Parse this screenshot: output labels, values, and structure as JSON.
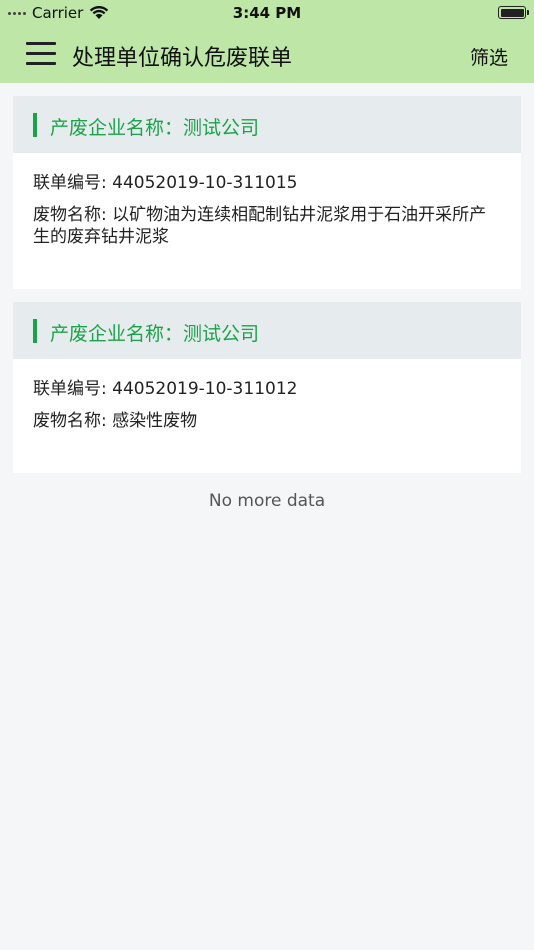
{
  "status_bar": {
    "carrier": "Carrier",
    "time": "3:44 PM"
  },
  "nav": {
    "title": "处理单位确认危废联单",
    "filter_label": "筛选"
  },
  "colors": {
    "nav_bg": "#bde6a7",
    "accent": "#1aa34a",
    "card_header_bg": "#e6eced"
  },
  "cards": [
    {
      "company": "产废企业名称：测试公司",
      "manifest": "联单编号: 44052019-10-311015",
      "waste": "废物名称: 以矿物油为连续相配制钻井泥浆用于石油开采所产生的废弃钻井泥浆"
    },
    {
      "company": "产废企业名称：测试公司",
      "manifest": "联单编号: 44052019-10-311012",
      "waste": "废物名称: 感染性废物"
    }
  ],
  "footer": {
    "no_more": "No more data"
  }
}
